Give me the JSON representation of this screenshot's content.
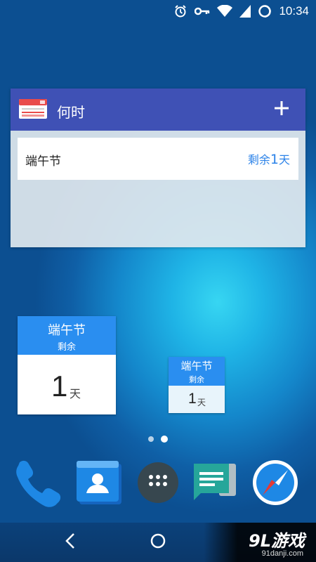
{
  "status_bar": {
    "time": "10:34",
    "icons": [
      "alarm-icon",
      "vpn-key-icon",
      "wifi-icon",
      "signal-icon",
      "battery-icon"
    ]
  },
  "agenda_widget": {
    "title": "何时",
    "add_icon": "plus-icon",
    "events": [
      {
        "name": "端午节",
        "remaining_prefix": "剩余",
        "remaining_days": "1",
        "remaining_unit": "天"
      }
    ]
  },
  "countdown_large": {
    "title": "端午节",
    "subtitle": "剩余",
    "days": "1",
    "unit": "天"
  },
  "countdown_small": {
    "title": "端午节",
    "subtitle": "剩余",
    "days": "1",
    "unit": "天"
  },
  "page_indicator": {
    "pages": 2,
    "current": 2
  },
  "dock": [
    "phone-icon",
    "contacts-icon",
    "app-drawer-icon",
    "messages-icon",
    "browser-icon"
  ],
  "navigation": [
    "back-icon",
    "home-icon"
  ],
  "watermark": {
    "logo": "9L游戏",
    "url": "91danji.com"
  },
  "colors": {
    "header_blue": "#3f51b5",
    "countdown_blue": "#2a8ef0",
    "remain_text": "#2b82e8"
  }
}
